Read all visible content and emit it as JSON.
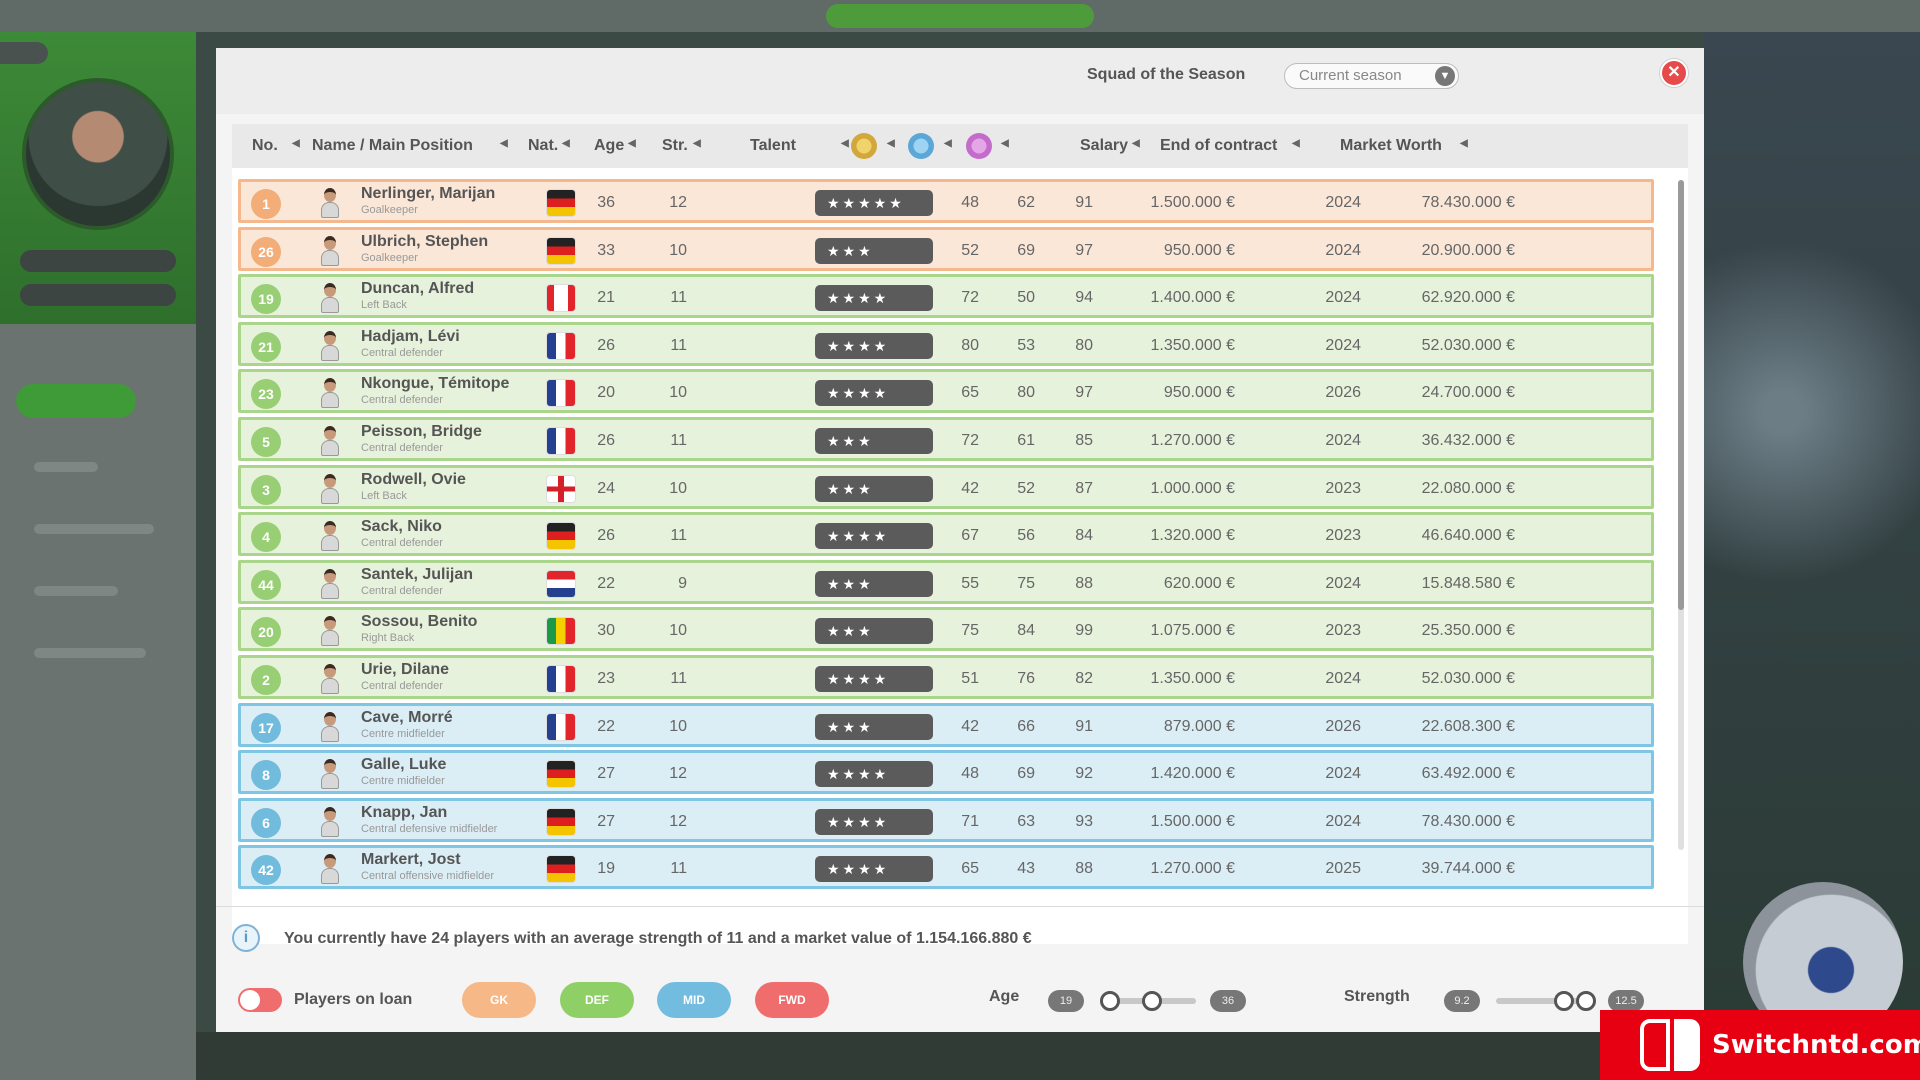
{
  "dialog": {
    "title": "Squad of the Season",
    "season_select": "Current season",
    "columns": {
      "no": "No.",
      "name": "Name / Main Position",
      "nat": "Nat.",
      "age": "Age",
      "str": "Str.",
      "talent": "Talent",
      "salary": "Salary",
      "contract": "End of contract",
      "worth": "Market Worth"
    },
    "players": [
      {
        "no": "1",
        "group": "gk",
        "name": "Nerlinger, Marijan",
        "pos": "Goalkeeper",
        "nat": "germany",
        "age": "36",
        "str": "12",
        "talent": "★★★★★",
        "a": "48",
        "b": "62",
        "c": "91",
        "salary": "1.500.000 €",
        "contract": "2024",
        "worth": "78.430.000 €"
      },
      {
        "no": "26",
        "group": "gk",
        "name": "Ulbrich, Stephen",
        "pos": "Goalkeeper",
        "nat": "germany",
        "age": "33",
        "str": "10",
        "talent": "★★★",
        "a": "52",
        "b": "69",
        "c": "97",
        "salary": "950.000 €",
        "contract": "2024",
        "worth": "20.900.000 €"
      },
      {
        "no": "19",
        "group": "def",
        "name": "Duncan, Alfred",
        "pos": "Left Back",
        "nat": "canada",
        "age": "21",
        "str": "11",
        "talent": "★★★★",
        "a": "72",
        "b": "50",
        "c": "94",
        "salary": "1.400.000 €",
        "contract": "2024",
        "worth": "62.920.000 €"
      },
      {
        "no": "21",
        "group": "def",
        "name": "Hadjam, Lévi",
        "pos": "Central defender",
        "nat": "france",
        "age": "26",
        "str": "11",
        "talent": "★★★★",
        "a": "80",
        "b": "53",
        "c": "80",
        "salary": "1.350.000 €",
        "contract": "2024",
        "worth": "52.030.000 €"
      },
      {
        "no": "23",
        "group": "def",
        "name": "Nkongue, Témitope",
        "pos": "Central defender",
        "nat": "france",
        "age": "20",
        "str": "10",
        "talent": "★★★★",
        "a": "65",
        "b": "80",
        "c": "97",
        "salary": "950.000 €",
        "contract": "2026",
        "worth": "24.700.000 €"
      },
      {
        "no": "5",
        "group": "def",
        "name": "Peisson, Bridge",
        "pos": "Central defender",
        "nat": "france",
        "age": "26",
        "str": "11",
        "talent": "★★★",
        "a": "72",
        "b": "61",
        "c": "85",
        "salary": "1.270.000 €",
        "contract": "2024",
        "worth": "36.432.000 €"
      },
      {
        "no": "3",
        "group": "def",
        "name": "Rodwell, Ovie",
        "pos": "Left Back",
        "nat": "england",
        "age": "24",
        "str": "10",
        "talent": "★★★",
        "a": "42",
        "b": "52",
        "c": "87",
        "salary": "1.000.000 €",
        "contract": "2023",
        "worth": "22.080.000 €"
      },
      {
        "no": "4",
        "group": "def",
        "name": "Sack, Niko",
        "pos": "Central defender",
        "nat": "germany",
        "age": "26",
        "str": "11",
        "talent": "★★★★",
        "a": "67",
        "b": "56",
        "c": "84",
        "salary": "1.320.000 €",
        "contract": "2023",
        "worth": "46.640.000 €"
      },
      {
        "no": "44",
        "group": "def",
        "name": "Santek, Julijan",
        "pos": "Central defender",
        "nat": "croatia",
        "age": "22",
        "str": "9",
        "talent": "★★★",
        "a": "55",
        "b": "75",
        "c": "88",
        "salary": "620.000 €",
        "contract": "2024",
        "worth": "15.848.580 €"
      },
      {
        "no": "20",
        "group": "def",
        "name": "Sossou, Benito",
        "pos": "Right Back",
        "nat": "senegal",
        "age": "30",
        "str": "10",
        "talent": "★★★",
        "a": "75",
        "b": "84",
        "c": "99",
        "salary": "1.075.000 €",
        "contract": "2023",
        "worth": "25.350.000 €"
      },
      {
        "no": "2",
        "group": "def",
        "name": "Urie, Dilane",
        "pos": "Central defender",
        "nat": "france",
        "age": "23",
        "str": "11",
        "talent": "★★★★",
        "a": "51",
        "b": "76",
        "c": "82",
        "salary": "1.350.000 €",
        "contract": "2024",
        "worth": "52.030.000 €"
      },
      {
        "no": "17",
        "group": "mid",
        "name": "Cave, Morré",
        "pos": "Centre midfielder",
        "nat": "france",
        "age": "22",
        "str": "10",
        "talent": "★★★",
        "a": "42",
        "b": "66",
        "c": "91",
        "salary": "879.000 €",
        "contract": "2026",
        "worth": "22.608.300 €"
      },
      {
        "no": "8",
        "group": "mid",
        "name": "Galle, Luke",
        "pos": "Centre midfielder",
        "nat": "germany",
        "age": "27",
        "str": "12",
        "talent": "★★★★",
        "a": "48",
        "b": "69",
        "c": "92",
        "salary": "1.420.000 €",
        "contract": "2024",
        "worth": "63.492.000 €"
      },
      {
        "no": "6",
        "group": "mid",
        "name": "Knapp, Jan",
        "pos": "Central defensive midfielder",
        "nat": "germany",
        "age": "27",
        "str": "12",
        "talent": "★★★★",
        "a": "71",
        "b": "63",
        "c": "93",
        "salary": "1.500.000 €",
        "contract": "2024",
        "worth": "78.430.000 €"
      },
      {
        "no": "42",
        "group": "mid",
        "name": "Markert, Jost",
        "pos": "Central offensive midfielder",
        "nat": "germany",
        "age": "19",
        "str": "11",
        "talent": "★★★★",
        "a": "65",
        "b": "43",
        "c": "88",
        "salary": "1.270.000 €",
        "contract": "2025",
        "worth": "39.744.000 €"
      }
    ],
    "info_text": "You currently have 24 players with an average strength of 11 and a market value of 1.154.166.880 €",
    "filters": {
      "loan_label": "Players on loan",
      "gk": "GK",
      "def": "DEF",
      "mid": "MID",
      "fwd": "FWD",
      "age_label": "Age",
      "age_min": "19",
      "age_max": "36",
      "strength_label": "Strength",
      "strength_min": "9.2",
      "strength_max": "12.5"
    }
  },
  "watermark": "Switchntd.com",
  "colors": {
    "gk": "#f4b88c",
    "def": "#a9d68a",
    "mid": "#7fc6e4",
    "close": "#e64a4a",
    "fwd": "#ef6d6d"
  }
}
